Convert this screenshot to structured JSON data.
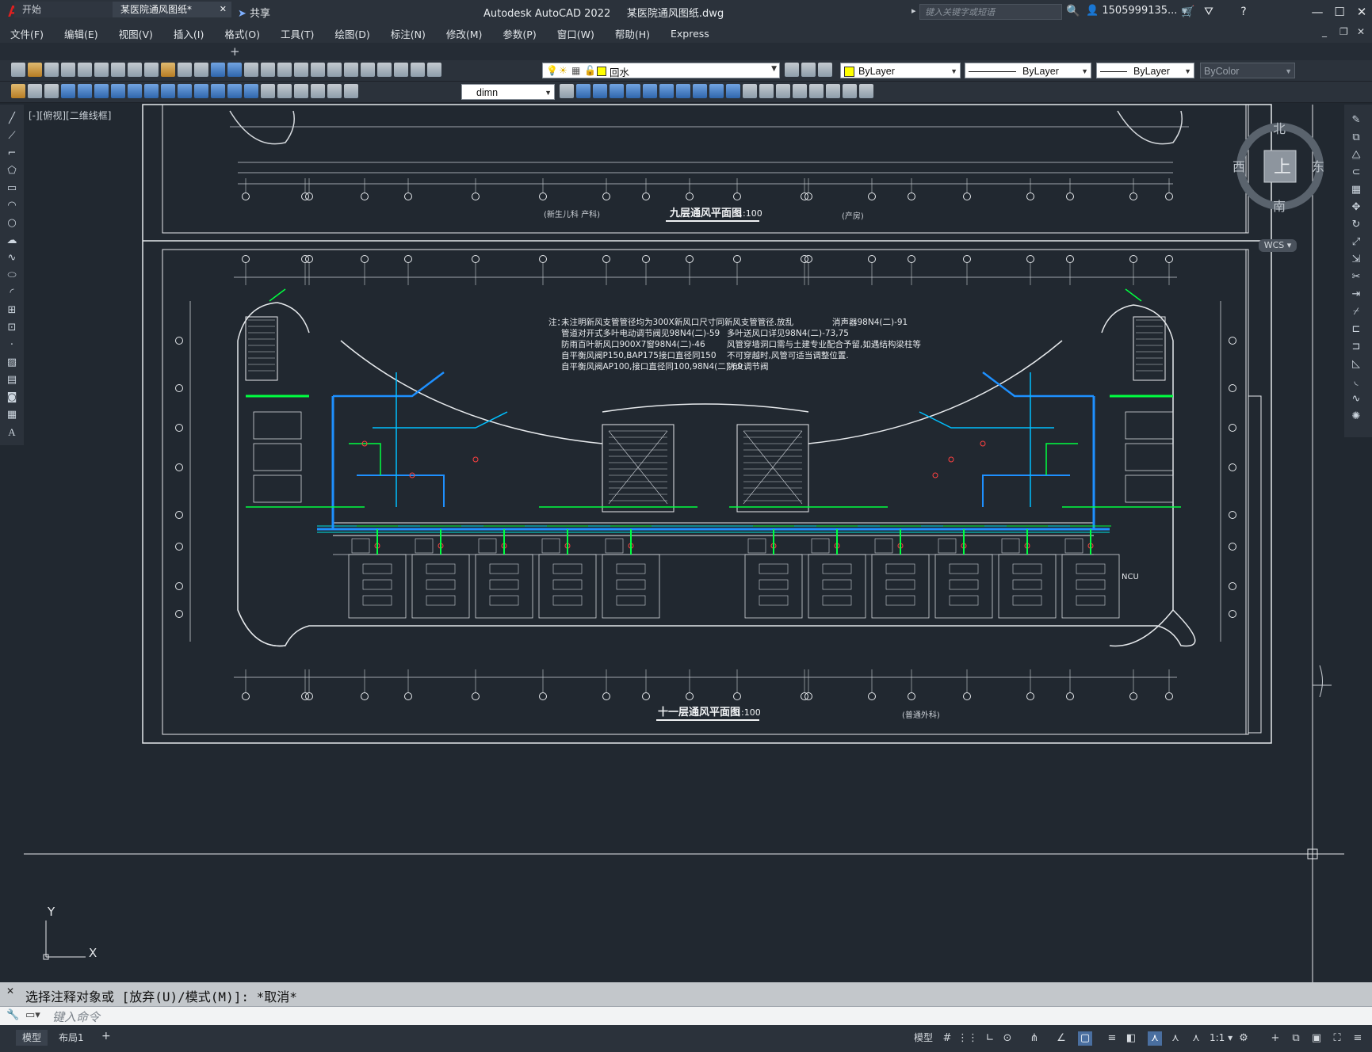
{
  "app": {
    "logo": "A",
    "title": "Autodesk AutoCAD 2022",
    "document_title": "某医院通风图纸.dwg",
    "share_label": "共享",
    "search_placeholder": "键入关键字或短语",
    "user_name": "1505999135..."
  },
  "menu": [
    "文件(F)",
    "编辑(E)",
    "视图(V)",
    "插入(I)",
    "格式(O)",
    "工具(T)",
    "绘图(D)",
    "标注(N)",
    "修改(M)",
    "参数(P)",
    "窗口(W)",
    "帮助(H)",
    "Express"
  ],
  "tabs": [
    {
      "label": "开始"
    },
    {
      "label": "某医院通风图纸*",
      "active": true
    }
  ],
  "properties_toolbar": {
    "layer": "回水",
    "color": "ByLayer",
    "linetype": "ByLayer",
    "lineweight": "ByLayer",
    "plotstyle": "ByColor"
  },
  "dim_style": "dimn",
  "viewport_label": "[-][俯视][二维线框]",
  "viewcube": {
    "top": "上",
    "north": "北",
    "south": "南",
    "east": "东",
    "west": "西",
    "wcs": "WCS"
  },
  "drawing": {
    "top_title": "九层通风平面图",
    "top_scale": "1:100",
    "top_note_left": "(新生儿科  产科)",
    "top_note_right": "(产房)",
    "bottom_title": "十一层通风平面图",
    "bottom_scale": "1:100",
    "bottom_note_right": "(普通外科)",
    "ncu_label": "NCU",
    "notes_prefix": "注：",
    "notes_left": [
      "未注明新风支管管径均为300X新风口尺寸同新风支管管径.放乱",
      "管道对开式多叶电动调节阀见98N4(二)-59",
      "防雨百叶新风口900X7窗98N4(二)-46",
      "自平衡风阀P150,BAP175接口直径同150",
      "自平衡风阀AP100,接口直径同100,98N4(二)-69"
    ],
    "notes_right": [
      "消声器98N4(二)-91",
      "多叶送风口详见98N4(二)-73,75",
      "风管穿墙洞口需与土建专业配合予留,如遇结构梁柱等",
      "不可穿越时,风管可适当调整位置.",
      "防火调节阀"
    ]
  },
  "ucs": {
    "y": "Y",
    "x": "X"
  },
  "command": {
    "history": "选择注释对象或 [放弃(U)/模式(M)]: *取消*",
    "placeholder": "键入命令"
  },
  "status": {
    "model_tab": "模型",
    "layout_tab": "布局1",
    "model_button": "模型",
    "scale": "1:1"
  }
}
